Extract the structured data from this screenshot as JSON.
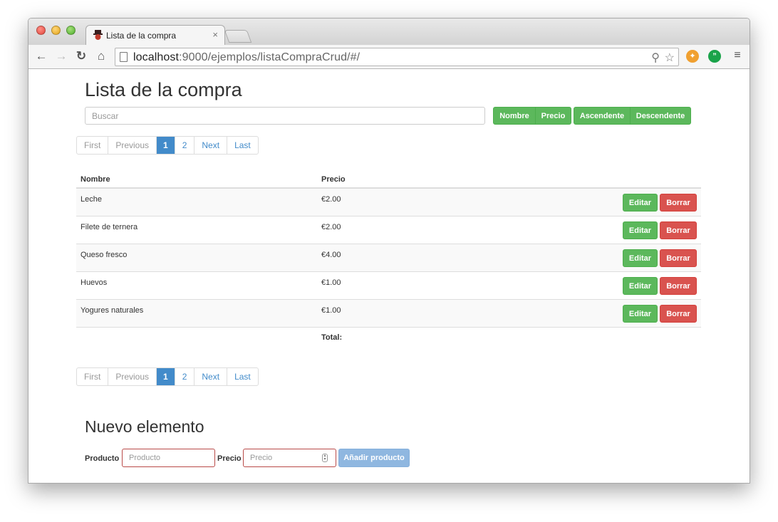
{
  "browser": {
    "tab_title": "Lista de la compra",
    "tab_close": "×",
    "url_host": "localhost",
    "url_rest": ":9000/ejemplos/listaCompraCrud/#/"
  },
  "page": {
    "title": "Lista de la compra",
    "search_placeholder": "Buscar",
    "sort_buttons": [
      "Nombre",
      "Precio"
    ],
    "order_buttons": [
      "Ascendente",
      "Descendente"
    ],
    "pager": [
      "First",
      "Previous",
      "1",
      "2",
      "Next",
      "Last"
    ],
    "table": {
      "headers": [
        "Nombre",
        "Precio"
      ],
      "rows": [
        {
          "nombre": "Leche",
          "precio": "€2.00"
        },
        {
          "nombre": "Filete de ternera",
          "precio": "€2.00"
        },
        {
          "nombre": "Queso fresco",
          "precio": "€4.00"
        },
        {
          "nombre": "Huevos",
          "precio": "€1.00"
        },
        {
          "nombre": "Yogures naturales",
          "precio": "€1.00"
        }
      ],
      "edit_label": "Editar",
      "delete_label": "Borrar",
      "total_label": "Total:"
    },
    "form": {
      "title": "Nuevo elemento",
      "producto_label": "Producto",
      "producto_placeholder": "Producto",
      "precio_label": "Precio",
      "precio_placeholder": "Precio",
      "submit_label": "Añadir producto"
    }
  },
  "colors": {
    "success": "#5cb85c",
    "danger": "#d9534f",
    "primary": "#428bca"
  }
}
